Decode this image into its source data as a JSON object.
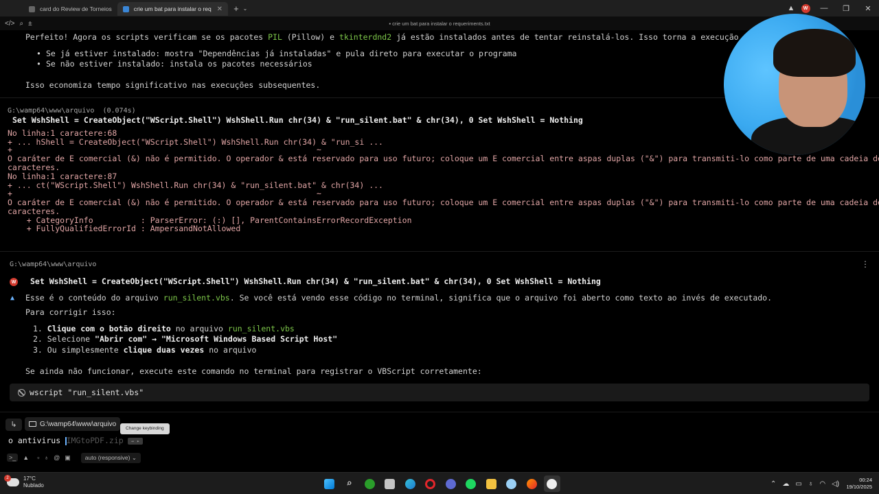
{
  "tabs": [
    {
      "label": "card do Review de Torneios"
    },
    {
      "label": "crie um bat para instalar o req"
    }
  ],
  "window": {
    "title": "crie um bat para instalar o requeriments.txt",
    "avatar_letter": "W"
  },
  "response1": {
    "intro_a": "Perfeito! Agora os scripts verificam se os pacotes ",
    "pkg1": "PIL",
    "intro_b": " (Pillow) e ",
    "pkg2": "tkinterdnd2",
    "intro_c": " já estão instalados antes de tentar reinstalá-los. Isso torna a execução muito mais r",
    "bullets": [
      "Se já estiver instalado: mostra \"Dependências já instaladas\" e pula direto para executar o programa",
      "Se não estiver instalado: instala os pacotes necessários"
    ],
    "outro": "Isso economiza tempo significativo nas execuções subsequentes."
  },
  "block1": {
    "path": "G:\\wamp64\\www\\arquivo  (0.074s)",
    "command": "Set WshShell = CreateObject(\"WScript.Shell\") WshShell.Run chr(34) & \"run_silent.bat\" & chr(34), 0 Set WshShell = Nothing",
    "error_lines": [
      "No linha:1 caractere:68",
      "+ ... hShell = CreateObject(\"WScript.Shell\") WshShell.Run chr(34) & \"run_si ...",
      "+                                                                ~",
      "O caráter de E comercial (&) não é permitido. O operador & está reservado para uso futuro; coloque um E comercial entre aspas duplas (\"&\") para transmiti-lo como parte de uma cadeia de",
      "caracteres.",
      "No linha:1 caractere:87",
      "+ ... ct(\"WScript.Shell\") WshShell.Run chr(34) & \"run_silent.bat\" & chr(34) ...",
      "+                                                                ~",
      "O caráter de E comercial (&) não é permitido. O operador & está reservado para uso futuro; coloque um E comercial entre aspas duplas (\"&\") para transmiti-lo como parte de uma cadeia de",
      "caracteres.",
      "    + CategoryInfo          : ParserError: (:) [], ParentContainsErrorRecordException",
      "    + FullyQualifiedErrorId : AmpersandNotAllowed"
    ]
  },
  "block2": {
    "path": "G:\\wamp64\\www\\arquivo",
    "user_avatar": "W",
    "user_command": "Set WshShell = CreateObject(\"WScript.Shell\") WshShell.Run chr(34) & \"run_silent.bat\" & chr(34), 0 Set WshShell = Nothing",
    "answer_a": "Esse é o conteúdo do arquivo ",
    "answer_file": "run_silent.vbs",
    "answer_b": ". Se você está vendo esse código no terminal, significa que o arquivo foi aberto como texto ao invés de executado.",
    "fix_title": "Para corrigir isso:",
    "steps": [
      {
        "num": "1.",
        "bold": "Clique com o botão direito",
        "mid": " no arquivo ",
        "hl": "run_silent.vbs",
        "end": ""
      },
      {
        "num": "2.",
        "pre": "Selecione ",
        "bold": "\"Abrir com\" → \"Microsoft Windows Based Script Host\""
      },
      {
        "num": "3.",
        "pre": "Ou simplesmente ",
        "bold": "clique duas vezes",
        "end": " no arquivo"
      }
    ],
    "fallback": "Se ainda não funcionar, execute este comando no terminal para registrar o VBScript corretamente:",
    "code": "wscript \"run_silent.vbs\""
  },
  "input": {
    "path_chip": "G:\\wamp64\\www\\arquivo",
    "tooltip": "Change keybinding",
    "typed": "o antivirus ",
    "suggestion": "IMGtoPDF.zip",
    "kbd": "→ ▸",
    "model": "auto (responsive)"
  },
  "taskbar": {
    "temp": "17°C",
    "weather": "Nublado",
    "time": "00:24",
    "date": "19/10/2025"
  }
}
